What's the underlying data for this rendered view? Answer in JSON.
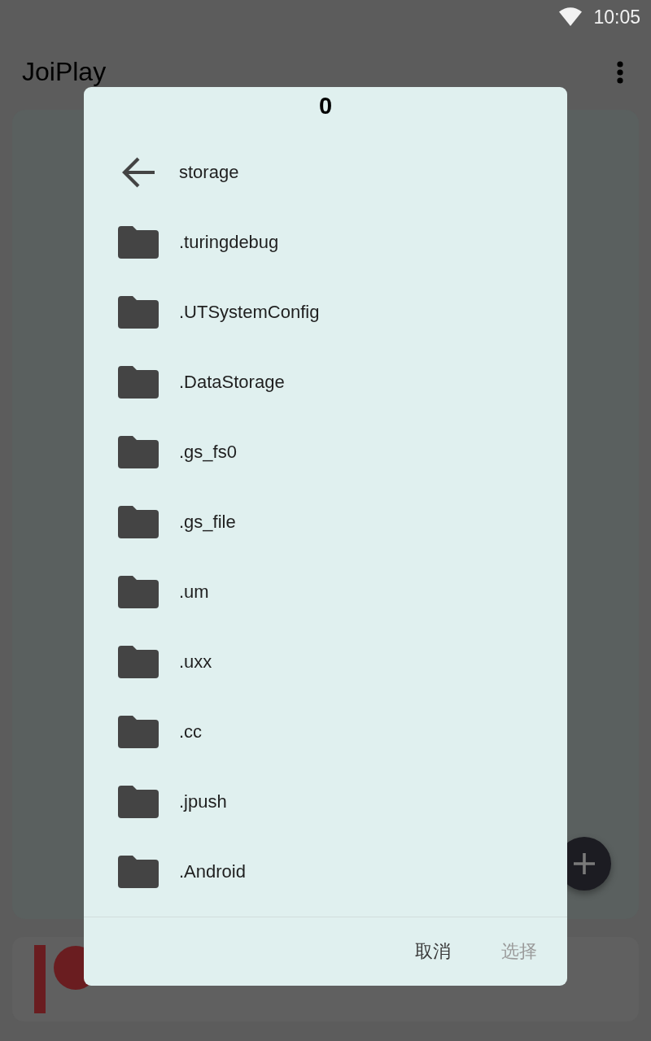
{
  "status_bar": {
    "time": "10:05"
  },
  "app_bar": {
    "title": "JoiPlay"
  },
  "dialog": {
    "title": "0",
    "path": "storage",
    "folders": [
      {
        "name": ".turingdebug"
      },
      {
        "name": ".UTSystemConfig"
      },
      {
        "name": ".DataStorage"
      },
      {
        "name": ".gs_fs0"
      },
      {
        "name": ".gs_file"
      },
      {
        "name": ".um"
      },
      {
        "name": ".uxx"
      },
      {
        "name": ".cc"
      },
      {
        "name": ".jpush"
      },
      {
        "name": ".Android"
      }
    ],
    "buttons": [
      {
        "label": "取消",
        "disabled": false
      },
      {
        "label": "选择",
        "disabled": true
      }
    ]
  }
}
